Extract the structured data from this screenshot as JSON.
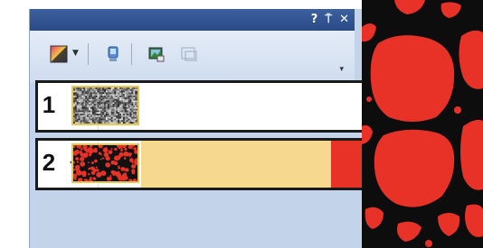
{
  "window": {
    "help_glyph": "?",
    "pin_glyph": "⍑",
    "close_glyph": "✕"
  },
  "toolbar": {
    "items": [
      {
        "icon": "color-swatch-icon"
      },
      {
        "icon": "dropdown-arrow-icon"
      },
      {
        "icon": "computer-icon"
      },
      {
        "icon": "image-layer-icon"
      },
      {
        "icon": "disabled-layer-icon"
      }
    ],
    "overflow_glyph": "▾"
  },
  "layers": [
    {
      "number": "1",
      "visible": false,
      "thumbnail": "grayscale-noise",
      "fill_color": "#ffffff"
    },
    {
      "number": "2",
      "visible": true,
      "thumbnail": "red-black-segmentation",
      "fill_color": "#f6d98e",
      "swatch_color": "#e83228"
    }
  ],
  "colors": {
    "titlebar": "#2f5193",
    "panel": "#c3d3e9",
    "segmentation_red": "#e83228",
    "highlight": "#f6d98e",
    "thumb_border": "#e8c84c"
  }
}
